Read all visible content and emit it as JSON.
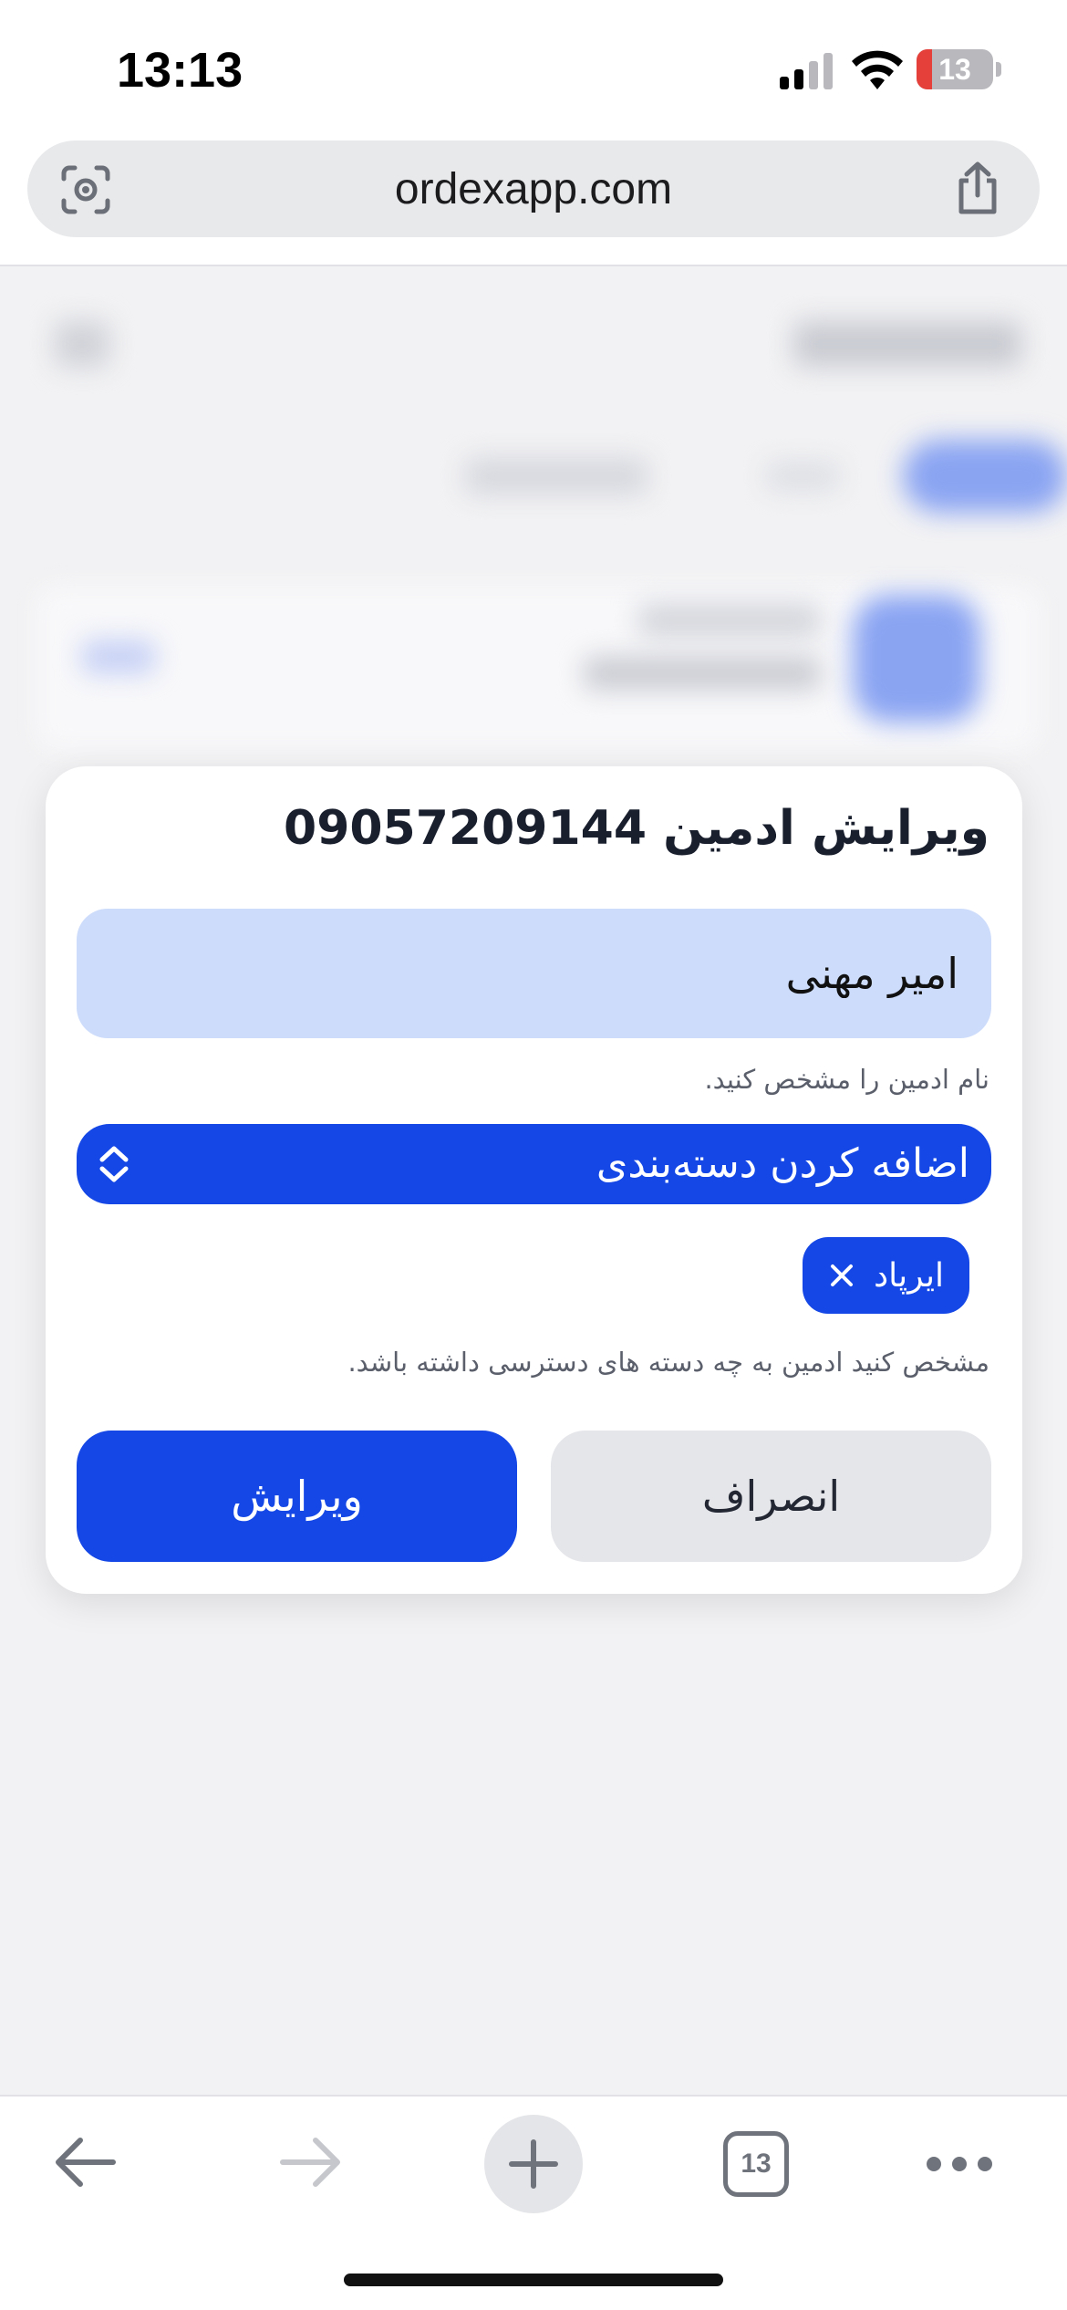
{
  "status_bar": {
    "time": "13:13",
    "battery": "13"
  },
  "browser": {
    "url": "ordexapp.com",
    "tab_count": "13"
  },
  "modal": {
    "title": "ویرایش ادمین 09057209144",
    "name_value": "امیر مهنی",
    "name_hint": "نام ادمین را مشخص کنید.",
    "category_select_label": "اضافه کردن دسته‌بندی",
    "selected_categories": [
      "ایرپاد"
    ],
    "category_hint": "مشخص کنید ادمین به چه دسته های دسترسی داشته باشد.",
    "cancel_label": "انصراف",
    "submit_label": "ویرایش"
  },
  "colors": {
    "primary": "#1447e6",
    "input_bg": "#cddcfb",
    "cancel_bg": "#e5e6ea",
    "battery_low": "#e5403a"
  },
  "icons": {
    "lens": "lens-icon",
    "share": "share-icon",
    "updown": "chevron-updown-icon",
    "chip_close": "close-icon",
    "back": "arrow-left-icon",
    "forward": "arrow-right-icon",
    "new_tab": "plus-icon",
    "more": "more-icon"
  }
}
